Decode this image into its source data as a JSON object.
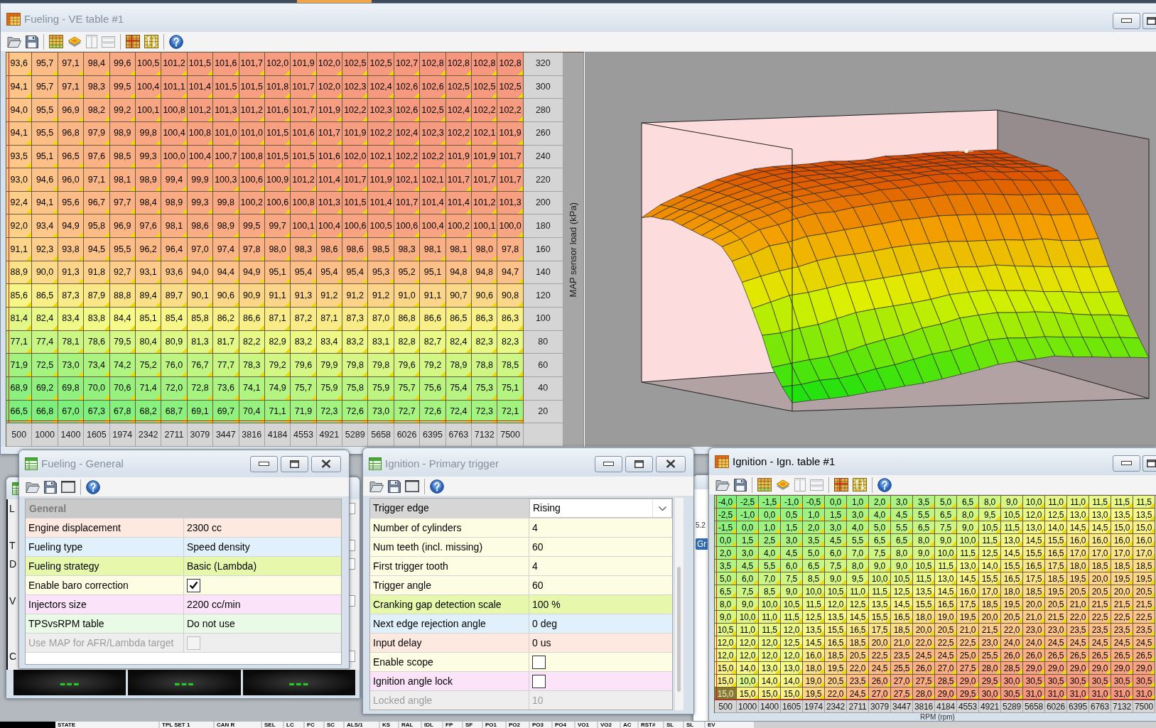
{
  "ve_window": {
    "title": "Fueling - VE table #1",
    "active": false,
    "table": {
      "rows": [
        {
          "load": "320",
          "cursor": false,
          "values": [
            "93,6",
            "95,7",
            "97,1",
            "98,4",
            "99,6",
            "100,5",
            "101,2",
            "101,5",
            "101,6",
            "101,7",
            "102,0",
            "101,9",
            "102,0",
            "102,5",
            "102,5",
            "102,7",
            "102,8",
            "102,8",
            "102,8",
            "102,8"
          ]
        },
        {
          "load": "300",
          "cursor": false,
          "values": [
            "94,1",
            "95,7",
            "97,1",
            "98,3",
            "99,5",
            "100,4",
            "101,1",
            "101,4",
            "101,5",
            "101,5",
            "101,8",
            "101,7",
            "102,0",
            "102,3",
            "102,4",
            "102,6",
            "102,6",
            "102,5",
            "102,5",
            "102,5"
          ]
        },
        {
          "load": "280",
          "cursor": false,
          "values": [
            "94,0",
            "95,5",
            "96,9",
            "98,2",
            "99,2",
            "100,1",
            "100,8",
            "101,2",
            "101,3",
            "101,2",
            "101,6",
            "101,7",
            "101,9",
            "102,2",
            "102,3",
            "102,6",
            "102,5",
            "102,4",
            "102,2",
            "102,2"
          ]
        },
        {
          "load": "260",
          "cursor": false,
          "values": [
            "94,1",
            "95,5",
            "96,8",
            "97,9",
            "98,9",
            "99,8",
            "100,4",
            "100,8",
            "101,0",
            "101,0",
            "101,5",
            "101,6",
            "101,7",
            "101,9",
            "102,2",
            "102,4",
            "102,3",
            "102,2",
            "102,1",
            "101,9"
          ]
        },
        {
          "load": "240",
          "cursor": false,
          "values": [
            "93,5",
            "95,1",
            "96,5",
            "97,6",
            "98,5",
            "99,3",
            "100,0",
            "100,4",
            "100,7",
            "100,8",
            "101,5",
            "101,5",
            "101,6",
            "102,0",
            "102,1",
            "102,2",
            "102,2",
            "101,9",
            "101,9",
            "101,7"
          ]
        },
        {
          "load": "220",
          "cursor": false,
          "values": [
            "93,0",
            "94,6",
            "96,0",
            "97,1",
            "98,1",
            "98,9",
            "99,4",
            "99,9",
            "100,3",
            "100,6",
            "100,9",
            "101,2",
            "101,4",
            "101,7",
            "101,9",
            "102,1",
            "102,1",
            "101,7",
            "101,7",
            "101,7"
          ]
        },
        {
          "load": "200",
          "cursor": false,
          "values": [
            "92,4",
            "94,1",
            "95,6",
            "96,7",
            "97,7",
            "98,4",
            "98,9",
            "99,3",
            "99,8",
            "100,2",
            "100,6",
            "100,8",
            "101,3",
            "101,5",
            "101,4",
            "101,7",
            "101,4",
            "101,4",
            "101,2",
            "101,3"
          ]
        },
        {
          "load": "180",
          "cursor": false,
          "values": [
            "92,0",
            "93,4",
            "94,9",
            "95,8",
            "96,9",
            "97,6",
            "98,1",
            "98,6",
            "98,9",
            "99,5",
            "99,7",
            "100,1",
            "100,4",
            "100,6",
            "100,5",
            "100,6",
            "100,4",
            "100,2",
            "100,1",
            "100,0"
          ]
        },
        {
          "load": "160",
          "cursor": false,
          "values": [
            "91,1",
            "92,3",
            "93,8",
            "94,5",
            "95,5",
            "96,2",
            "96,4",
            "97,0",
            "97,4",
            "97,8",
            "98,0",
            "98,3",
            "98,6",
            "98,6",
            "98,5",
            "98,3",
            "98,1",
            "98,1",
            "98,0",
            "97,8"
          ]
        },
        {
          "load": "140",
          "cursor": false,
          "values": [
            "88,9",
            "90,0",
            "91,3",
            "91,8",
            "92,7",
            "93,1",
            "93,6",
            "94,0",
            "94,4",
            "94,9",
            "95,1",
            "95,4",
            "95,4",
            "95,4",
            "95,3",
            "95,2",
            "95,1",
            "94,8",
            "94,8",
            "94,7"
          ]
        },
        {
          "load": "120",
          "cursor": false,
          "values": [
            "85,6",
            "86,5",
            "87,3",
            "87,9",
            "88,8",
            "89,4",
            "89,7",
            "90,1",
            "90,6",
            "90,9",
            "91,1",
            "91,3",
            "91,2",
            "91,2",
            "91,2",
            "91,0",
            "91,1",
            "90,7",
            "90,6",
            "90,8"
          ]
        },
        {
          "load": "100",
          "cursor": false,
          "values": [
            "81,4",
            "82,4",
            "83,4",
            "83,8",
            "84,4",
            "85,1",
            "85,4",
            "85,8",
            "86,2",
            "86,6",
            "87,1",
            "87,2",
            "87,1",
            "87,3",
            "87,0",
            "86,8",
            "86,6",
            "86,5",
            "86,3",
            "86,3"
          ]
        },
        {
          "load": "80",
          "cursor": false,
          "values": [
            "77,1",
            "77,4",
            "78,1",
            "78,6",
            "79,5",
            "80,4",
            "80,9",
            "81,3",
            "81,7",
            "82,2",
            "82,9",
            "83,2",
            "83,4",
            "83,2",
            "83,1",
            "82,8",
            "82,7",
            "82,4",
            "82,3",
            "82,3"
          ]
        },
        {
          "load": "60",
          "cursor": false,
          "values": [
            "71,9",
            "72,5",
            "73,0",
            "73,4",
            "74,2",
            "75,2",
            "76,0",
            "76,7",
            "77,7",
            "78,3",
            "79,2",
            "79,6",
            "79,9",
            "79,8",
            "79,8",
            "79,6",
            "79,2",
            "78,9",
            "78,8",
            "78,5"
          ]
        },
        {
          "load": "40",
          "cursor": false,
          "values": [
            "68,9",
            "69,2",
            "69,8",
            "70,0",
            "70,6",
            "71,4",
            "72,0",
            "72,8",
            "73,6",
            "74,1",
            "74,9",
            "75,7",
            "75,9",
            "75,8",
            "75,9",
            "75,7",
            "75,6",
            "75,4",
            "75,3",
            "75,1"
          ]
        },
        {
          "load": "20",
          "cursor": true,
          "values": [
            "66,5",
            "66,8",
            "67,0",
            "67,3",
            "67,8",
            "68,2",
            "68,7",
            "69,1",
            "69,7",
            "70,4",
            "71,1",
            "71,9",
            "72,3",
            "72,6",
            "73,0",
            "72,7",
            "72,6",
            "72,4",
            "72,3",
            "72,1"
          ]
        }
      ],
      "rpm_axis": [
        {
          "label": "500",
          "cursor": true
        },
        {
          "label": "1000",
          "cursor": false
        },
        {
          "label": "1400",
          "cursor": false
        },
        {
          "label": "1605",
          "cursor": false
        },
        {
          "label": "1974",
          "cursor": false
        },
        {
          "label": "2342",
          "cursor": false
        },
        {
          "label": "2711",
          "cursor": false
        },
        {
          "label": "3079",
          "cursor": false
        },
        {
          "label": "3447",
          "cursor": false
        },
        {
          "label": "3816",
          "cursor": false
        },
        {
          "label": "4184",
          "cursor": false
        },
        {
          "label": "4553",
          "cursor": false
        },
        {
          "label": "4921",
          "cursor": false
        },
        {
          "label": "5289",
          "cursor": false
        },
        {
          "label": "5658",
          "cursor": false
        },
        {
          "label": "6026",
          "cursor": false
        },
        {
          "label": "6395",
          "cursor": false
        },
        {
          "label": "6763",
          "cursor": false
        },
        {
          "label": "7132",
          "cursor": false
        },
        {
          "label": "7500",
          "cursor": false
        }
      ],
      "load_axis_title": "MAP sensor load (kPa)"
    }
  },
  "dashboard_window": {
    "labels": [
      "L",
      "T",
      "D",
      "V",
      "C"
    ],
    "gauges": [
      "---",
      "---",
      "---"
    ]
  },
  "background_window": {
    "text": "5.2",
    "button": "Gr"
  },
  "fueling_general_window": {
    "title": "Fueling - General",
    "active": false,
    "section": "General",
    "rows": [
      {
        "label": "Engine displacement",
        "kind": "text",
        "value": "2300 cc",
        "color": "#fde9e0",
        "disabled": false
      },
      {
        "label": "Fueling type",
        "kind": "text",
        "value": "Speed density",
        "color": "#e1f1fb",
        "disabled": false
      },
      {
        "label": "Fueling strategy",
        "kind": "text",
        "value": "Basic (Lambda)",
        "color": "#e7f7ac",
        "disabled": false
      },
      {
        "label": "Enable baro correction",
        "kind": "checkbox",
        "checked": true,
        "color": "#fdfde3",
        "disabled": false
      },
      {
        "label": "Injectors size",
        "kind": "text",
        "value": "2200 cc/min",
        "color": "#fbe3f9",
        "disabled": false
      },
      {
        "label": "TPSvsRPM table",
        "kind": "text",
        "value": "Do not use",
        "color": "#e9fbe6",
        "disabled": false
      },
      {
        "label": "Use MAP for AFR/Lambda target",
        "kind": "checkbox",
        "checked": false,
        "color": "#eeeeee",
        "disabled": true
      }
    ]
  },
  "primary_trigger_window": {
    "title": "Ignition - Primary trigger",
    "active": false,
    "rows": [
      {
        "label": "Trigger edge",
        "kind": "dropdown",
        "value": "Rising",
        "selected": true,
        "disabled": false
      },
      {
        "label": "Number of cylinders",
        "kind": "text",
        "value": "4",
        "color": "#fdfde3",
        "selected": false,
        "disabled": false
      },
      {
        "label": "Num teeth (incl. missing)",
        "kind": "text",
        "value": "60",
        "color": "#fdfde3",
        "selected": false,
        "disabled": false
      },
      {
        "label": "First trigger tooth",
        "kind": "text",
        "value": "4",
        "color": "#fdfde3",
        "selected": false,
        "disabled": false
      },
      {
        "label": "Trigger angle",
        "kind": "text",
        "value": "60",
        "color": "#fdfde3",
        "selected": false,
        "disabled": false
      },
      {
        "label": "Cranking gap detection scale",
        "kind": "text",
        "value": "100 %",
        "color": "#e7f7ac",
        "selected": false,
        "disabled": false
      },
      {
        "label": "Next edge rejection angle",
        "kind": "text",
        "value": "0 deg",
        "color": "#e1f1fb",
        "selected": false,
        "disabled": false
      },
      {
        "label": "Input delay",
        "kind": "text",
        "value": "0 us",
        "color": "#fde9e0",
        "selected": false,
        "disabled": false
      },
      {
        "label": "Enable scope",
        "kind": "checkbox",
        "checked": false,
        "color": "#fdfde3",
        "selected": false,
        "disabled": false
      },
      {
        "label": "Ignition angle lock",
        "kind": "checkbox",
        "checked": false,
        "color": "#fbe3f9",
        "selected": false,
        "disabled": false
      },
      {
        "label": "Locked angle",
        "kind": "text",
        "value": "10",
        "color": "#eeeeee",
        "selected": false,
        "disabled": true
      }
    ]
  },
  "ignition_window": {
    "title": "Ignition - Ign. table #1",
    "active": true,
    "table": {
      "rows": [
        {
          "cursor": false,
          "values": [
            "-4,0",
            "-2,5",
            "-1,5",
            "-1,0",
            "-0,5",
            "0,0",
            "1,0",
            "2,0",
            "3,0",
            "3,5",
            "5,0",
            "6,5",
            "8,0",
            "9,0",
            "10,0",
            "11,0",
            "11,0",
            "11,5",
            "11,5",
            "11,5"
          ]
        },
        {
          "cursor": false,
          "values": [
            "-2,5",
            "-1,0",
            "0,0",
            "0,5",
            "1,0",
            "1,5",
            "3,0",
            "4,0",
            "4,5",
            "5,5",
            "6,5",
            "8,0",
            "9,5",
            "10,5",
            "12,0",
            "12,5",
            "13,0",
            "13,0",
            "13,5",
            "13,5"
          ]
        },
        {
          "cursor": false,
          "values": [
            "-1,5",
            "0,0",
            "1,0",
            "1,5",
            "2,0",
            "3,0",
            "4,0",
            "5,0",
            "5,5",
            "6,5",
            "7,5",
            "9,0",
            "10,5",
            "11,5",
            "13,0",
            "14,0",
            "14,5",
            "14,5",
            "15,0",
            "15,0"
          ]
        },
        {
          "cursor": false,
          "values": [
            "0,0",
            "1,5",
            "2,5",
            "3,0",
            "3,5",
            "4,5",
            "5,5",
            "6,5",
            "6,5",
            "8,0",
            "9,0",
            "10,0",
            "11,5",
            "13,0",
            "14,5",
            "15,5",
            "16,0",
            "16,0",
            "16,0",
            "16,0"
          ]
        },
        {
          "cursor": false,
          "values": [
            "2,0",
            "3,0",
            "4,0",
            "4,5",
            "5,0",
            "6,0",
            "7,0",
            "7,5",
            "8,0",
            "9,0",
            "10,0",
            "11,5",
            "12,5",
            "14,5",
            "15,5",
            "16,5",
            "17,0",
            "17,0",
            "17,0",
            "17,0"
          ]
        },
        {
          "cursor": false,
          "values": [
            "3,5",
            "4,5",
            "5,5",
            "6,0",
            "6,5",
            "7,5",
            "8,0",
            "9,0",
            "9,0",
            "10,5",
            "11,5",
            "13,0",
            "14,0",
            "15,5",
            "16,5",
            "17,5",
            "18,0",
            "18,5",
            "18,5",
            "18,5"
          ]
        },
        {
          "cursor": false,
          "values": [
            "5,0",
            "6,0",
            "7,0",
            "7,5",
            "8,5",
            "9,0",
            "9,5",
            "10,0",
            "10,5",
            "11,5",
            "13,0",
            "14,5",
            "15,5",
            "16,5",
            "17,5",
            "18,5",
            "19,5",
            "20,0",
            "19,5",
            "19,5"
          ]
        },
        {
          "cursor": false,
          "values": [
            "6,5",
            "7,5",
            "8,5",
            "9,0",
            "10,0",
            "10,5",
            "11,0",
            "11,5",
            "12,5",
            "13,5",
            "14,5",
            "16,0",
            "17,0",
            "18,0",
            "18,5",
            "19,5",
            "20,5",
            "20,5",
            "20,0",
            "20,5"
          ]
        },
        {
          "cursor": false,
          "values": [
            "8,0",
            "9,0",
            "10,0",
            "10,5",
            "11,5",
            "12,0",
            "12,5",
            "13,5",
            "14,5",
            "15,5",
            "16,5",
            "17,5",
            "18,5",
            "19,5",
            "20,0",
            "20,5",
            "21,0",
            "21,5",
            "21,5",
            "21,5"
          ]
        },
        {
          "cursor": false,
          "values": [
            "9,0",
            "10,0",
            "11,0",
            "11,5",
            "12,5",
            "13,5",
            "14,5",
            "15,5",
            "16,5",
            "18,0",
            "19,0",
            "19,5",
            "20,0",
            "20,5",
            "21,0",
            "21,5",
            "22,0",
            "22,5",
            "22,5",
            "22,5"
          ]
        },
        {
          "cursor": false,
          "values": [
            "10,5",
            "11,0",
            "11,5",
            "12,0",
            "13,5",
            "15,5",
            "16,5",
            "17,5",
            "18,5",
            "20,0",
            "20,5",
            "21,0",
            "21,5",
            "22,0",
            "23,0",
            "23,0",
            "23,5",
            "23,5",
            "23,5",
            "23,5"
          ]
        },
        {
          "cursor": false,
          "values": [
            "12,0",
            "12,0",
            "12,0",
            "12,5",
            "14,5",
            "16,5",
            "18,5",
            "20,0",
            "21,0",
            "22,0",
            "22,5",
            "22,5",
            "23,0",
            "24,0",
            "24,0",
            "24,5",
            "24,5",
            "24,5",
            "24,5",
            "24,5"
          ]
        },
        {
          "cursor": false,
          "values": [
            "12,0",
            "12,0",
            "12,0",
            "12,0",
            "16,0",
            "18,5",
            "20,5",
            "22,5",
            "23,5",
            "24,5",
            "24,5",
            "25,0",
            "25,5",
            "26,0",
            "26,0",
            "26,5",
            "26,5",
            "26,5",
            "26,5",
            "26,5"
          ]
        },
        {
          "cursor": false,
          "values": [
            "15,0",
            "14,0",
            "13,0",
            "13,0",
            "18,0",
            "19,5",
            "22,0",
            "24,5",
            "25,5",
            "26,0",
            "27,0",
            "27,5",
            "28,0",
            "28,5",
            "29,0",
            "29,0",
            "29,0",
            "29,0",
            "29,0",
            "29,0"
          ]
        },
        {
          "cursor": false,
          "values": [
            "15,0",
            "10,0",
            "14,0",
            "14,0",
            "19,0",
            "20,5",
            "23,5",
            "26,0",
            "27,0",
            "27,5",
            "28,5",
            "29,0",
            "29,5",
            "30,0",
            "30,5",
            "30,5",
            "30,5",
            "30,5",
            "30,5",
            "30,5"
          ]
        },
        {
          "cursor": true,
          "values": [
            "15,0",
            "15,0",
            "15,0",
            "15,0",
            "19,5",
            "22,0",
            "24,5",
            "27,0",
            "27,5",
            "28,0",
            "29,0",
            "29,5",
            "30,0",
            "30,5",
            "31,0",
            "31,0",
            "31,0",
            "31,0",
            "31,0",
            "31,0"
          ]
        }
      ],
      "rpm_axis": [
        {
          "label": "500",
          "cursor": true
        },
        {
          "label": "1000",
          "cursor": false
        },
        {
          "label": "1400",
          "cursor": false
        },
        {
          "label": "1605",
          "cursor": false
        },
        {
          "label": "1974",
          "cursor": false
        },
        {
          "label": "2342",
          "cursor": false
        },
        {
          "label": "2711",
          "cursor": false
        },
        {
          "label": "3079",
          "cursor": false
        },
        {
          "label": "3447",
          "cursor": false
        },
        {
          "label": "3816",
          "cursor": false
        },
        {
          "label": "4184",
          "cursor": false
        },
        {
          "label": "4553",
          "cursor": false
        },
        {
          "label": "4921",
          "cursor": false
        },
        {
          "label": "5289",
          "cursor": false
        },
        {
          "label": "5658",
          "cursor": false
        },
        {
          "label": "6026",
          "cursor": false
        },
        {
          "label": "6395",
          "cursor": false
        },
        {
          "label": "6763",
          "cursor": false
        },
        {
          "label": "7132",
          "cursor": false
        },
        {
          "label": "7500",
          "cursor": false
        }
      ],
      "rpm_axis_title": "RPM (rpm)"
    }
  },
  "status_bar": {
    "cells": [
      "STATE",
      "TPL SET 1",
      "CAN R",
      "SEL",
      "LC",
      "FC",
      "SC",
      "ALS/1",
      "KS",
      "RAL",
      "IDL",
      "FP",
      "SF",
      "PO1",
      "PO2",
      "PO3",
      "PO4",
      "VO1",
      "VO2",
      "AC",
      "RST#",
      "SL",
      "SL",
      "EV"
    ]
  }
}
